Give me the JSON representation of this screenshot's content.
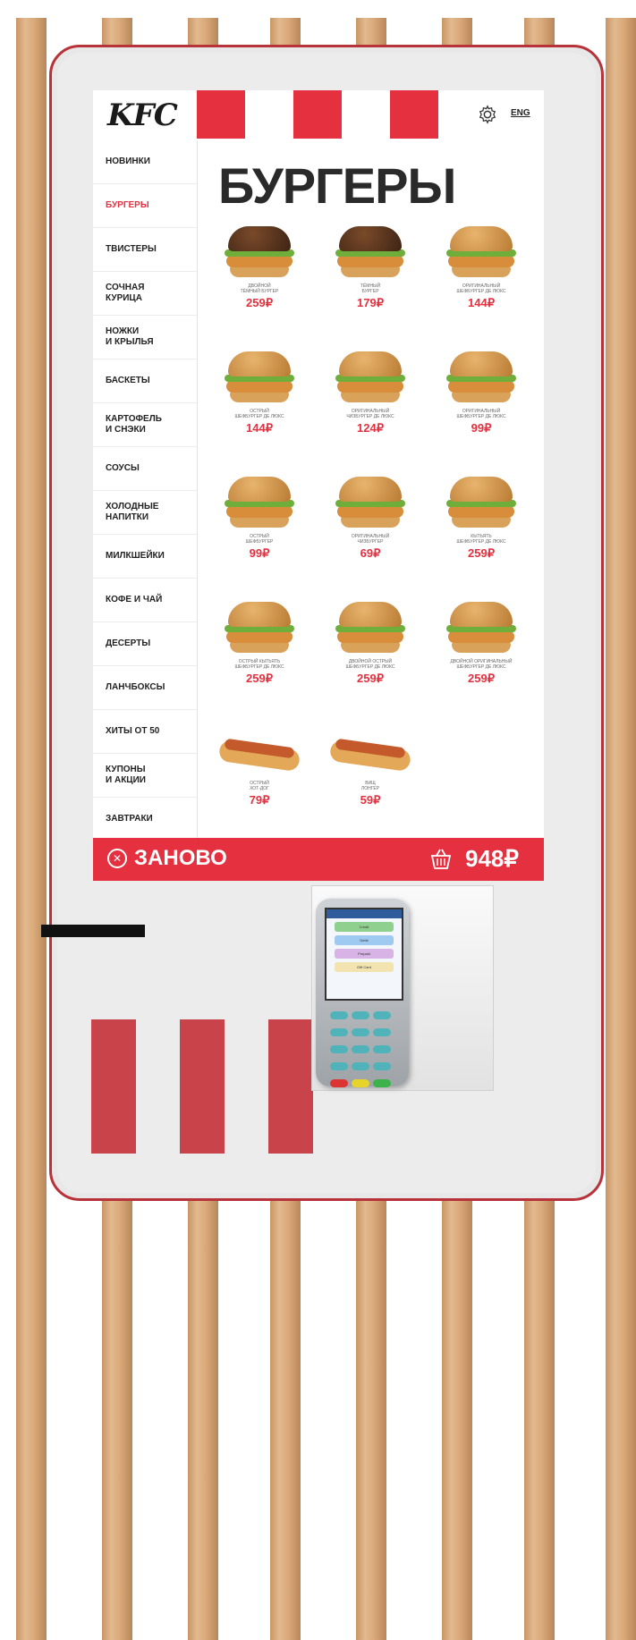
{
  "header": {
    "logo": "KFC",
    "lang": "ENG"
  },
  "sidebar": {
    "items": [
      {
        "label": "НОВИНКИ",
        "active": false
      },
      {
        "label": "БУРГЕРЫ",
        "active": true
      },
      {
        "label": "ТВИСТЕРЫ",
        "active": false
      },
      {
        "label": "СОЧНАЯ\nКУРИЦА",
        "active": false
      },
      {
        "label": "НОЖКИ\nИ КРЫЛЬЯ",
        "active": false
      },
      {
        "label": "БАСКЕТЫ",
        "active": false
      },
      {
        "label": "КАРТОФЕЛЬ\nИ СНЭКИ",
        "active": false
      },
      {
        "label": "СОУСЫ",
        "active": false
      },
      {
        "label": "ХОЛОДНЫЕ\nНАПИТКИ",
        "active": false
      },
      {
        "label": "МИЛКШЕЙКИ",
        "active": false
      },
      {
        "label": "КОФЕ И ЧАЙ",
        "active": false
      },
      {
        "label": "ДЕСЕРТЫ",
        "active": false
      },
      {
        "label": "ЛАНЧБОКСЫ",
        "active": false
      },
      {
        "label": "ХИТЫ ОТ 50",
        "active": false
      },
      {
        "label": "КУПОНЫ\nИ АКЦИИ",
        "active": false
      },
      {
        "label": "ЗАВТРАКИ",
        "active": false
      }
    ]
  },
  "main": {
    "title": "БУРГЕРЫ",
    "products": [
      {
        "name": "ДВОЙНОЙ\nТЁМНЫЙ БУРГЕР",
        "price": "259₽",
        "kind": "burger-dark"
      },
      {
        "name": "ТЁМНЫЙ\nБУРГЕР",
        "price": "179₽",
        "kind": "burger-dark"
      },
      {
        "name": "ОРИГИНАЛЬНЫЙ\nШЕФБУРГЕР ДЕ ЛЮКС",
        "price": "144₽",
        "kind": "burger"
      },
      {
        "name": "ОСТРЫЙ\nШЕФБУРГЕР ДЕ ЛЮКС",
        "price": "144₽",
        "kind": "burger"
      },
      {
        "name": "ОРИГИНАЛЬНЫЙ\nЧИЗБУРГЕР ДЕ ЛЮКС",
        "price": "124₽",
        "kind": "burger"
      },
      {
        "name": "ОРИГИНАЛЬНЫЙ\nШЕФБУРГЕР ДЕ ЛЮКС",
        "price": "99₽",
        "kind": "burger"
      },
      {
        "name": "ОСТРЫЙ\nШЕФБУРГЕР",
        "price": "99₽",
        "kind": "burger"
      },
      {
        "name": "ОРИГИНАЛЬНЫЙ\nЧИЗБУРГЕР",
        "price": "69₽",
        "kind": "burger"
      },
      {
        "name": "КЫТЬЯТЬ\nШЕФБУРГЕР ДЕ ЛЮКС",
        "price": "259₽",
        "kind": "burger"
      },
      {
        "name": "ОСТРЫЙ КЫТЬЯТЬ\nШЕФБУРГЕР ДЕ ЛЮКС",
        "price": "259₽",
        "kind": "burger"
      },
      {
        "name": "ДВОЙНОЙ ОСТРЫЙ\nШЕФБУРГЕР ДЕ ЛЮКС",
        "price": "259₽",
        "kind": "burger"
      },
      {
        "name": "ДВОЙНОЙ ОРИГИНАЛЬНЫЙ\nШЕФБУРГЕР ДЕ ЛЮКС",
        "price": "259₽",
        "kind": "burger"
      },
      {
        "name": "ОСТРЫЙ\nХОТ-ДОГ",
        "price": "79₽",
        "kind": "hotdog"
      },
      {
        "name": "ВИЩ\nЛОНГЕР",
        "price": "59₽",
        "kind": "hotdog"
      }
    ]
  },
  "footer": {
    "restart_label": "ЗАНОВО",
    "total": "948₽"
  },
  "terminal": {
    "buttons": [
      "Credit",
      "Debit",
      "Prepaid",
      "Gift Card"
    ],
    "colors": [
      "#8fd08f",
      "#9ec9f0",
      "#d7b3e6",
      "#f2e3b0"
    ]
  },
  "colors": {
    "brand_red": "#e4303f"
  }
}
